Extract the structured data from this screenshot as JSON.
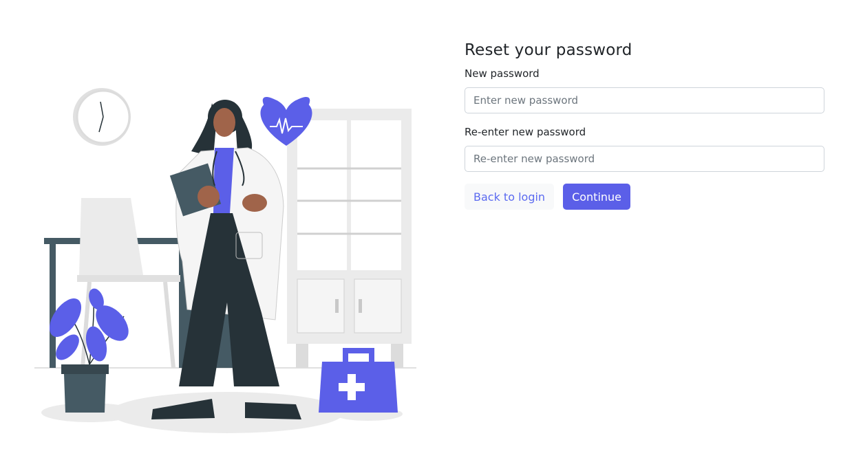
{
  "form": {
    "title": "Reset your password",
    "new_password_label": "New password",
    "new_password_placeholder": "Enter new password",
    "confirm_password_label": "Re-enter new password",
    "confirm_password_placeholder": "Re-enter new password",
    "back_button_label": "Back to login",
    "continue_button_label": "Continue"
  },
  "colors": {
    "accent": "#5b5fe8",
    "link": "#5b6af0",
    "illustration_gray": "#ebebeb",
    "illustration_dark": "#263238"
  },
  "icons": [
    "clock-icon",
    "heart-pulse-icon",
    "medical-kit-icon",
    "plant-icon"
  ]
}
